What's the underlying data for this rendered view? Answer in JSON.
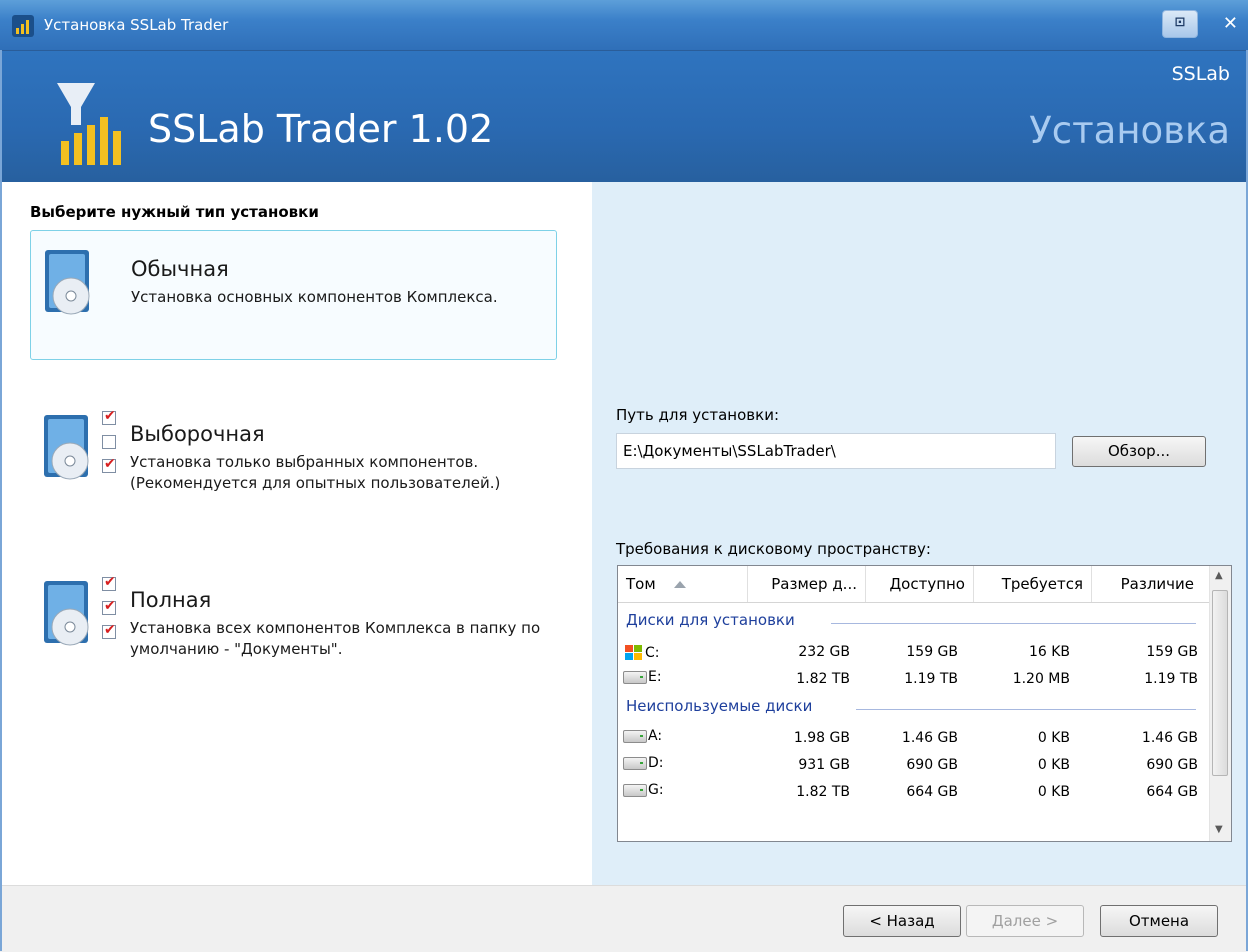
{
  "window": {
    "title": "Установка SSLab Trader",
    "restore_glyph": "⊡",
    "close_glyph": "✕"
  },
  "banner": {
    "product": "SSLab Trader 1.02",
    "brand": "SSLab",
    "phase": "Установка"
  },
  "install_type": {
    "heading": "Выберите нужный тип установки",
    "options": [
      {
        "title": "Обычная",
        "description": "Установка основных компонентов Комплекса.",
        "selected": true
      },
      {
        "title": "Выборочная",
        "description": "Установка только выбранных компонентов. (Рекомендуется для опытных пользователей.)",
        "selected": false
      },
      {
        "title": "Полная",
        "description": "Установка всех компонентов Комплекса в папку по умолчанию - \"Документы\".",
        "selected": false
      }
    ]
  },
  "path": {
    "label": "Путь для установки:",
    "value": "E:\\Документы\\SSLabTrader\\",
    "browse_label": "Обзор..."
  },
  "disk": {
    "label": "Требования к дисковому пространству:",
    "columns": [
      "Том",
      "Размер д...",
      "Доступно",
      "Требуется",
      "Различие"
    ],
    "groups": [
      {
        "title": "Диски для установки",
        "rows": [
          {
            "volume": "C:",
            "icon": "windows-drive-icon",
            "size": "232 GB",
            "available": "159 GB",
            "required": "16 KB",
            "difference": "159 GB"
          },
          {
            "volume": "E:",
            "icon": "hard-drive-icon",
            "size": "1.82 TB",
            "available": "1.19 TB",
            "required": "1.20 MB",
            "difference": "1.19 TB"
          }
        ]
      },
      {
        "title": "Неиспользуемые диски",
        "rows": [
          {
            "volume": "A:",
            "icon": "hard-drive-icon",
            "size": "1.98 GB",
            "available": "1.46 GB",
            "required": "0 KB",
            "difference": "1.46 GB"
          },
          {
            "volume": "D:",
            "icon": "hard-drive-icon",
            "size": "931 GB",
            "available": "690 GB",
            "required": "0 KB",
            "difference": "690 GB"
          },
          {
            "volume": "G:",
            "icon": "hard-drive-icon",
            "size": "1.82 TB",
            "available": "664 GB",
            "required": "0 KB",
            "difference": "664 GB"
          }
        ]
      }
    ]
  },
  "footer": {
    "back_label": "< Назад",
    "next_label": "Далее >",
    "cancel_label": "Отмена"
  },
  "colors": {
    "accent": "#2f74bf",
    "right_panel_bg": "#dfeef9",
    "group_text": "#1e3f9c",
    "selected_border": "#7ed1e7"
  }
}
